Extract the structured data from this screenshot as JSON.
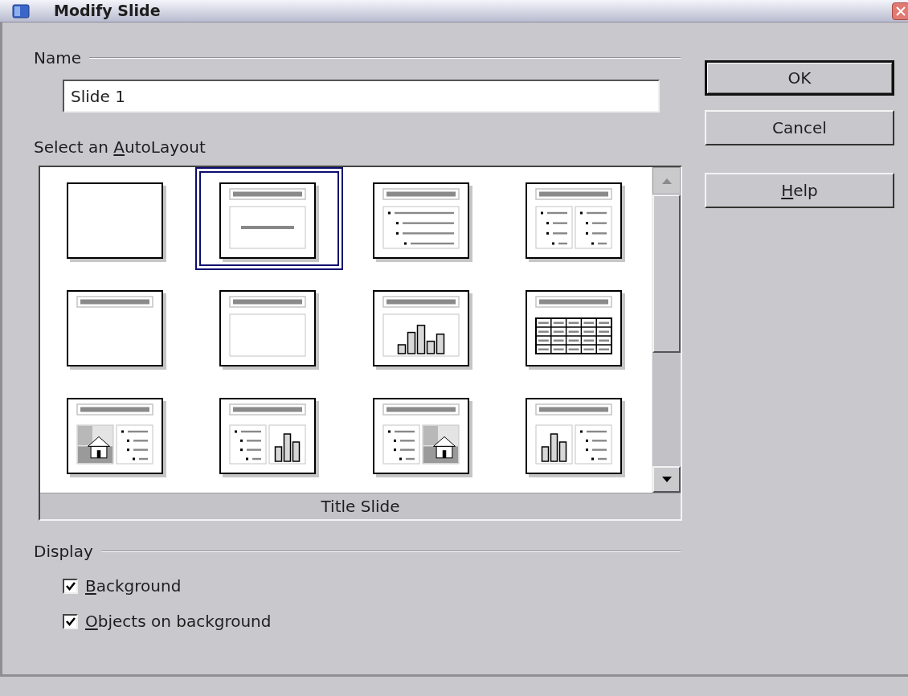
{
  "window": {
    "title": "Modify Slide"
  },
  "name_section": {
    "label": "Name",
    "value": "Slide 1"
  },
  "autolayout": {
    "label": {
      "before": "Select an ",
      "key": "A",
      "after": "utoLayout"
    },
    "layouts": [
      {
        "kind": "blank",
        "selected": false
      },
      {
        "kind": "title",
        "selected": true
      },
      {
        "kind": "bullets",
        "selected": false
      },
      {
        "kind": "two-bullets",
        "selected": false
      },
      {
        "kind": "title-only",
        "selected": false
      },
      {
        "kind": "box",
        "selected": false
      },
      {
        "kind": "chart",
        "selected": false
      },
      {
        "kind": "table",
        "selected": false
      },
      {
        "kind": "image-bullets",
        "selected": false
      },
      {
        "kind": "bullets-chart",
        "selected": false
      },
      {
        "kind": "bullets-image",
        "selected": false
      },
      {
        "kind": "chart-bullets",
        "selected": false
      }
    ],
    "caption": "Title Slide"
  },
  "display": {
    "label": "Display",
    "options": [
      {
        "label": {
          "key": "B",
          "after": "ackground"
        },
        "checked": true
      },
      {
        "label": {
          "key": "O",
          "after": "bjects on background"
        },
        "checked": true
      }
    ]
  },
  "buttons": [
    {
      "label": {
        "after": "OK"
      },
      "default": true
    },
    {
      "label": {
        "after": "Cancel"
      },
      "default": false
    },
    {
      "label": {
        "key": "H",
        "after": "elp"
      },
      "default": false
    }
  ]
}
